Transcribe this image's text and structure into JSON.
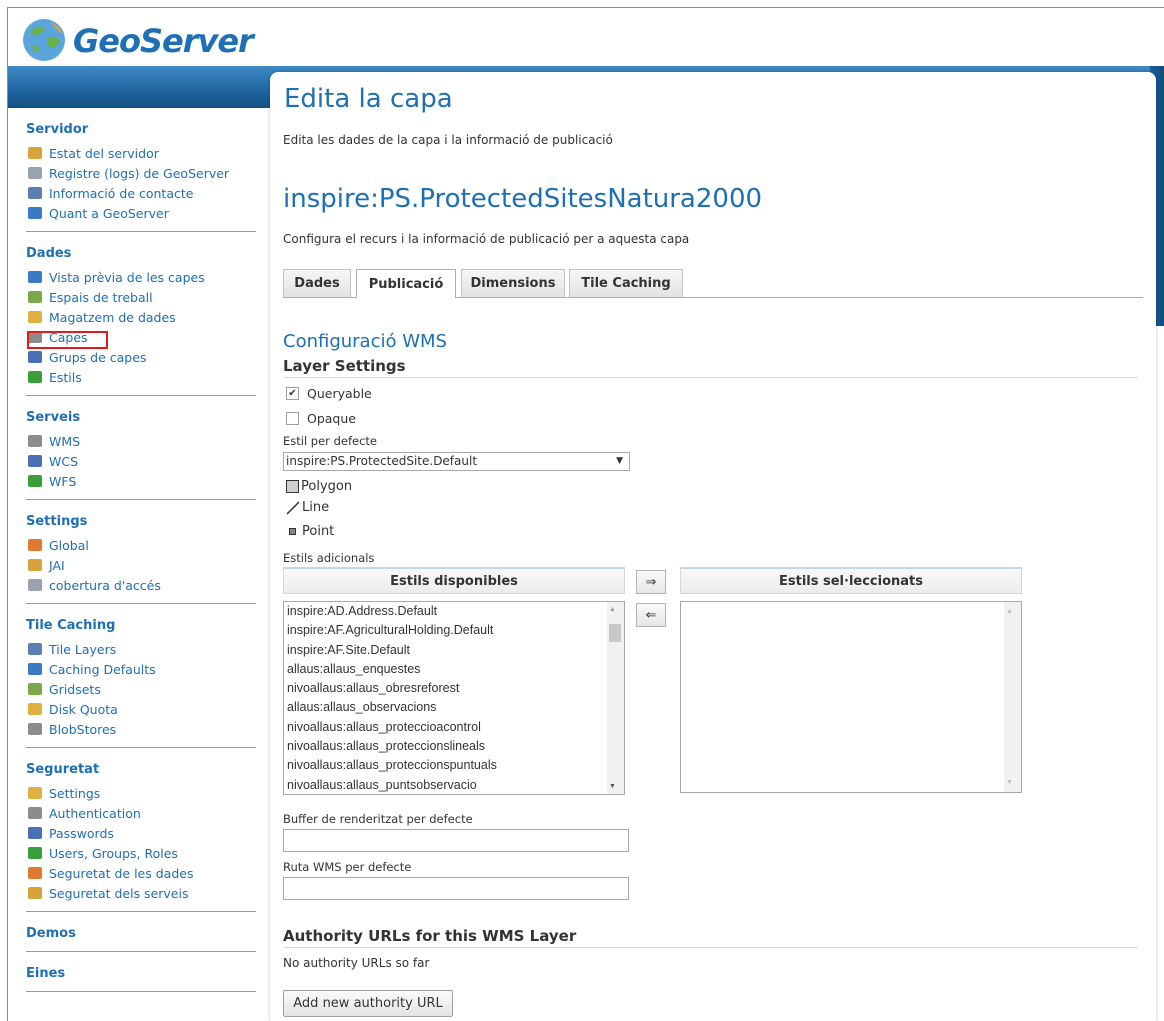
{
  "app": {
    "name": "GeoServer"
  },
  "sidebar": {
    "sections": [
      {
        "title": "Servidor",
        "items": [
          {
            "label": "Estat del servidor",
            "icon": "server-status-icon"
          },
          {
            "label": "Registre (logs) de GeoServer",
            "icon": "log-file-icon"
          },
          {
            "label": "Informació de contacte",
            "icon": "contact-card-icon"
          },
          {
            "label": "Quant a GeoServer",
            "icon": "about-icon"
          }
        ]
      },
      {
        "title": "Dades",
        "items": [
          {
            "label": "Vista prèvia de les capes",
            "icon": "layer-preview-icon"
          },
          {
            "label": "Espais de treball",
            "icon": "folder-icon"
          },
          {
            "label": "Magatzem de dades",
            "icon": "datastore-icon"
          },
          {
            "label": "Capes",
            "icon": "layers-icon"
          },
          {
            "label": "Grups de capes",
            "icon": "layer-groups-icon"
          },
          {
            "label": "Estils",
            "icon": "palette-icon"
          }
        ]
      },
      {
        "title": "Serveis",
        "items": [
          {
            "label": "WMS",
            "icon": "service-icon"
          },
          {
            "label": "WCS",
            "icon": "service-icon"
          },
          {
            "label": "WFS",
            "icon": "service-icon"
          }
        ]
      },
      {
        "title": "Settings",
        "items": [
          {
            "label": "Global",
            "icon": "global-settings-icon"
          },
          {
            "label": "JAI",
            "icon": "jai-icon"
          },
          {
            "label": "cobertura d'accés",
            "icon": "coverage-access-icon"
          }
        ]
      },
      {
        "title": "Tile Caching",
        "items": [
          {
            "label": "Tile Layers",
            "icon": "tile-layers-icon"
          },
          {
            "label": "Caching Defaults",
            "icon": "globe-icon"
          },
          {
            "label": "Gridsets",
            "icon": "grid-icon"
          },
          {
            "label": "Disk Quota",
            "icon": "disk-icon"
          },
          {
            "label": "BlobStores",
            "icon": "blobstore-icon"
          }
        ]
      },
      {
        "title": "Seguretat",
        "items": [
          {
            "label": "Settings",
            "icon": "key-icon"
          },
          {
            "label": "Authentication",
            "icon": "shield-icon"
          },
          {
            "label": "Passwords",
            "icon": "lock-icon"
          },
          {
            "label": "Users, Groups, Roles",
            "icon": "users-icon"
          },
          {
            "label": "Seguretat de les dades",
            "icon": "data-security-icon"
          },
          {
            "label": "Seguretat dels serveis",
            "icon": "service-security-icon"
          }
        ]
      },
      {
        "title": "Demos",
        "items": []
      },
      {
        "title": "Eines",
        "items": []
      }
    ]
  },
  "page": {
    "title": "Edita la capa",
    "description": "Edita les dades de la capa i la informació de publicació",
    "layer_name": "inspire:PS.ProtectedSitesNatura2000",
    "layer_description": "Configura el recurs i la informació de publicació per a aquesta capa"
  },
  "tabs": [
    {
      "label": "Dades",
      "active": false
    },
    {
      "label": "Publicació",
      "active": true
    },
    {
      "label": "Dimensions",
      "active": false
    },
    {
      "label": "Tile Caching",
      "active": false
    }
  ],
  "wms": {
    "title": "Configuració WMS",
    "layer_settings_title": "Layer Settings",
    "queryable_label": "Queryable",
    "queryable_checked": true,
    "opaque_label": "Opaque",
    "opaque_checked": false,
    "default_style_label": "Estil per defecte",
    "default_style_value": "inspire:PS.ProtectedSite.Default",
    "legend": {
      "polygon": "Polygon",
      "line": "Line",
      "point": "Point"
    },
    "additional_styles_label": "Estils adicionals",
    "available_header": "Estils disponibles",
    "selected_header": "Estils sel·leccionats",
    "available_styles": [
      "inspire:AD.Address.Default",
      "inspire:AF.AgriculturalHolding.Default",
      "inspire:AF.Site.Default",
      "allaus:allaus_enquestes",
      "nivoallaus:allaus_obresreforest",
      "allaus:allaus_observacions",
      "nivoallaus:allaus_proteccioacontrol",
      "nivoallaus:allaus_proteccionslineals",
      "nivoallaus:allaus_proteccionspuntuals",
      "nivoallaus:allaus_puntsobservacio"
    ],
    "move_right_glyph": "⇒",
    "move_left_glyph": "⇐",
    "buffer_label": "Buffer de renderitzat per defecte",
    "buffer_value": "",
    "wms_path_label": "Ruta WMS per defecte",
    "wms_path_value": ""
  },
  "authority": {
    "title": "Authority URLs for this WMS Layer",
    "empty_text": "No authority URLs so far",
    "add_button": "Add new authority URL"
  },
  "colors": {
    "accent": "#1e6fb5",
    "highlight_box": "#e01b1b"
  }
}
